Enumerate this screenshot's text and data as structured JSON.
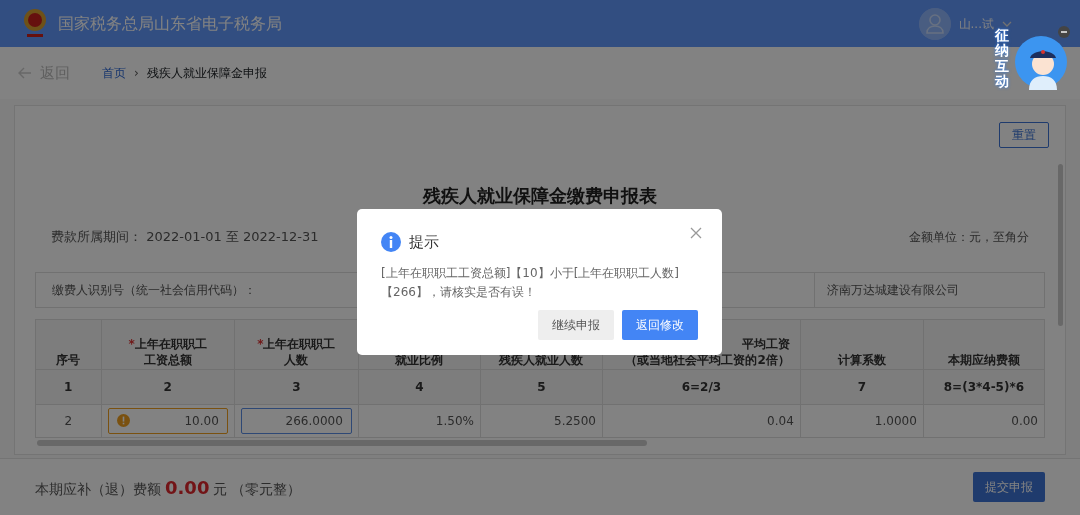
{
  "header": {
    "title": "国家税务总局山东省电子税务局",
    "user": "山...试"
  },
  "mascot": {
    "label": "征纳互动"
  },
  "breadcrumb": {
    "back": "返回",
    "items": [
      {
        "label": "首页",
        "link": true
      },
      {
        "label": "残疾人就业保障金申报",
        "link": false
      }
    ],
    "separator": "›"
  },
  "reset_button": "重置",
  "form": {
    "title": "残疾人就业保障金缴费申报表",
    "period_label": "费款所属期间：",
    "period": "2022-01-01 至 2022-12-31",
    "unit": "金额单位：元，至角分",
    "taxpayer_label": "缴费人识别号（统一社会信用代码）：",
    "company": "济南万达城建设有限公司"
  },
  "table": {
    "required_mark": "*",
    "columns": [
      {
        "lines": [
          "序号"
        ],
        "required": false,
        "number": "1"
      },
      {
        "lines": [
          "上年在职职工",
          "工资总额"
        ],
        "required": true,
        "number": "2"
      },
      {
        "lines": [
          "上年在职职工",
          "人数"
        ],
        "required": true,
        "number": "3"
      },
      {
        "lines": [
          "就业比例"
        ],
        "required": false,
        "number": "4"
      },
      {
        "lines": [
          "残疾人就业人数"
        ],
        "required": false,
        "number": "5"
      },
      {
        "lines": [
          "平均工资",
          "（或当地社会平均工资的2倍）"
        ],
        "required": false,
        "number": "6=2/3",
        "kind": "offset"
      },
      {
        "lines": [
          "计算系数"
        ],
        "required": false,
        "number": "7"
      },
      {
        "lines": [
          "本期应纳费额"
        ],
        "required": false,
        "number": "8=(3*4-5)*6"
      }
    ],
    "rows": [
      {
        "cells": [
          {
            "kind": "index",
            "value": "2"
          },
          {
            "kind": "input",
            "value": "10.00",
            "warning": true,
            "focused": false
          },
          {
            "kind": "input",
            "value": "266.0000",
            "warning": false,
            "focused": true
          },
          {
            "kind": "text",
            "value": "1.50%"
          },
          {
            "kind": "text",
            "value": "5.2500"
          },
          {
            "kind": "text",
            "value": "0.04"
          },
          {
            "kind": "text",
            "value": "1.0000"
          },
          {
            "kind": "text",
            "value": "0.00"
          }
        ]
      }
    ]
  },
  "footer": {
    "label": "本期应补（退）费额",
    "amount": "0.00",
    "unit": "元",
    "words": "（零元整）",
    "submit": "提交申报"
  },
  "dialog": {
    "title": "提示",
    "message": "[上年在职职工工资总额]【10】小于[上年在职职工人数]【266】，请核实是否有误！",
    "buttons": [
      {
        "label": "继续申报",
        "primary": false
      },
      {
        "label": "返回修改",
        "primary": true
      }
    ]
  }
}
